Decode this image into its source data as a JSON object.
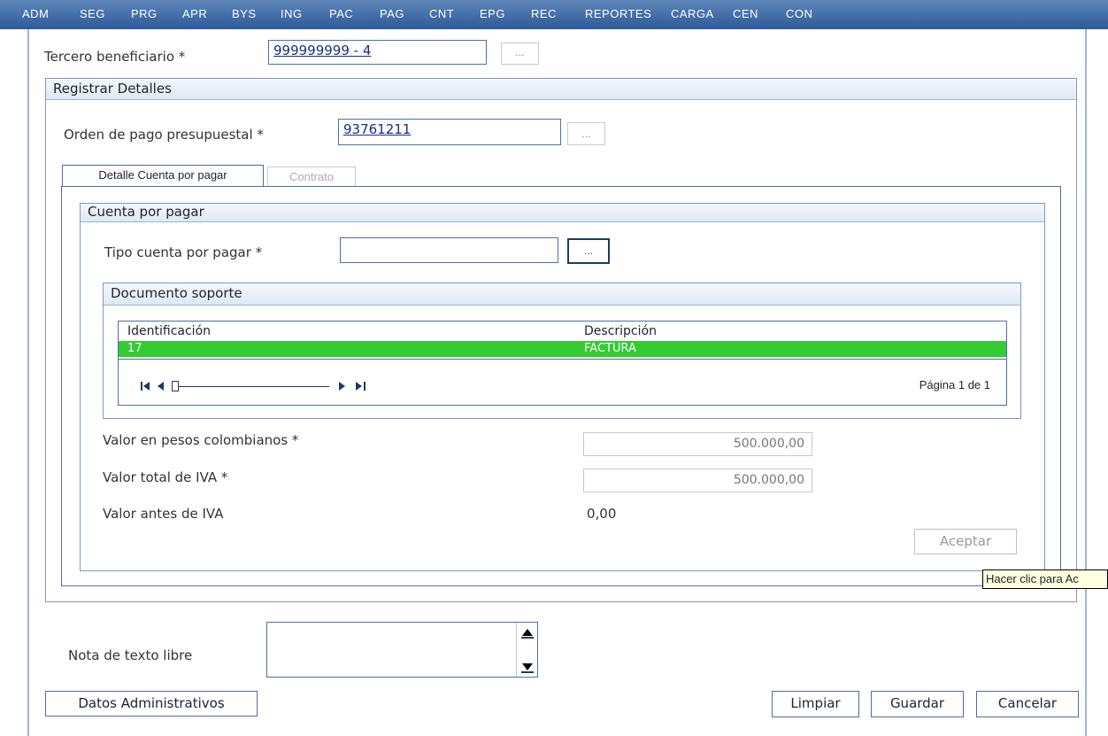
{
  "menu": [
    "ADM",
    "SEG",
    "PRG",
    "APR",
    "BYS",
    "ING",
    "PAC",
    "PAG",
    "CNT",
    "EPG",
    "REC",
    "REPORTES",
    "CARGA",
    "CEN",
    "CON"
  ],
  "form": {
    "tercero_label": "Tercero beneficiario *",
    "tercero_value": "999999999 - 4",
    "lookup_label": "...",
    "registrar_title": "Registrar Detalles",
    "orden_label": "Orden de pago presupuestal *",
    "orden_value": "93761211"
  },
  "tabs": [
    {
      "label": "Detalle Cuenta por pagar",
      "active": true
    },
    {
      "label": "Contrato",
      "active": false
    }
  ],
  "cuenta": {
    "title": "Cuenta por pagar",
    "tipo_label": "Tipo cuenta por pagar *",
    "tipo_value": ""
  },
  "documento": {
    "title": "Documento soporte",
    "columns": [
      "Identificación",
      "Descripción"
    ],
    "rows": [
      {
        "id": "17",
        "descripcion": "FACTURA",
        "selected": true
      }
    ],
    "pagination": "Página 1 de 1"
  },
  "valores": {
    "pesos_label": "Valor en pesos colombianos *",
    "pesos_value": "500.000,00",
    "iva_label": "Valor total de IVA *",
    "iva_value": "500.000,00",
    "antes_label": "Valor antes de IVA",
    "antes_value": "0,00",
    "aceptar_label": "Aceptar"
  },
  "tooltip": "Hacer clic para Ac",
  "nota_label": "Nota de texto libre",
  "footer": {
    "datos_admin": "Datos Administrativos",
    "limpiar": "Limpiar",
    "guardar": "Guardar",
    "cancelar": "Cancelar"
  },
  "colors": {
    "menu_bg": "#2c5a9a",
    "selected_row": "#33cc33",
    "panel_border": "#7c98c4"
  }
}
